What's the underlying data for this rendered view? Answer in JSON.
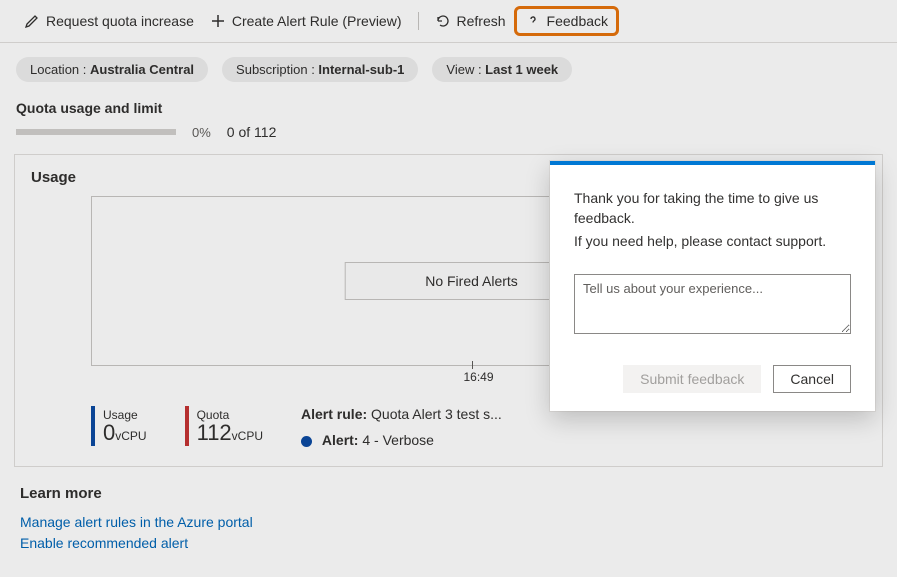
{
  "toolbar": {
    "request_quota": "Request quota increase",
    "create_alert": "Create Alert Rule (Preview)",
    "refresh": "Refresh",
    "feedback": "Feedback"
  },
  "filters": {
    "location_label": "Location : ",
    "location_value": "Australia Central",
    "subscription_label": "Subscription : ",
    "subscription_value": "Internal-sub-1",
    "view_label": "View : ",
    "view_value": "Last 1 week"
  },
  "quota": {
    "title": "Quota usage and limit",
    "percent": "0%",
    "of_text": "0 of 112"
  },
  "usage_card": {
    "title": "Usage",
    "no_alerts": "No Fired Alerts",
    "tick_label": "16:49",
    "usage_label": "Usage",
    "usage_value": "0",
    "usage_unit": "vCPU",
    "quota_label": "Quota",
    "quota_value": "112",
    "quota_unit": "vCPU",
    "alert_rule_label": "Alert rule:",
    "alert_rule_value": " Quota Alert 3 test s...",
    "alert_label": "Alert:",
    "alert_value": " 4 - Verbose"
  },
  "learn": {
    "title": "Learn more",
    "link1": "Manage alert rules in the Azure portal",
    "link2": "Enable recommended alert"
  },
  "dialog": {
    "line1": "Thank you for taking the time to give us feedback.",
    "line2": "If you need help, please contact support.",
    "placeholder": "Tell us about your experience...",
    "submit": "Submit feedback",
    "cancel": "Cancel"
  }
}
